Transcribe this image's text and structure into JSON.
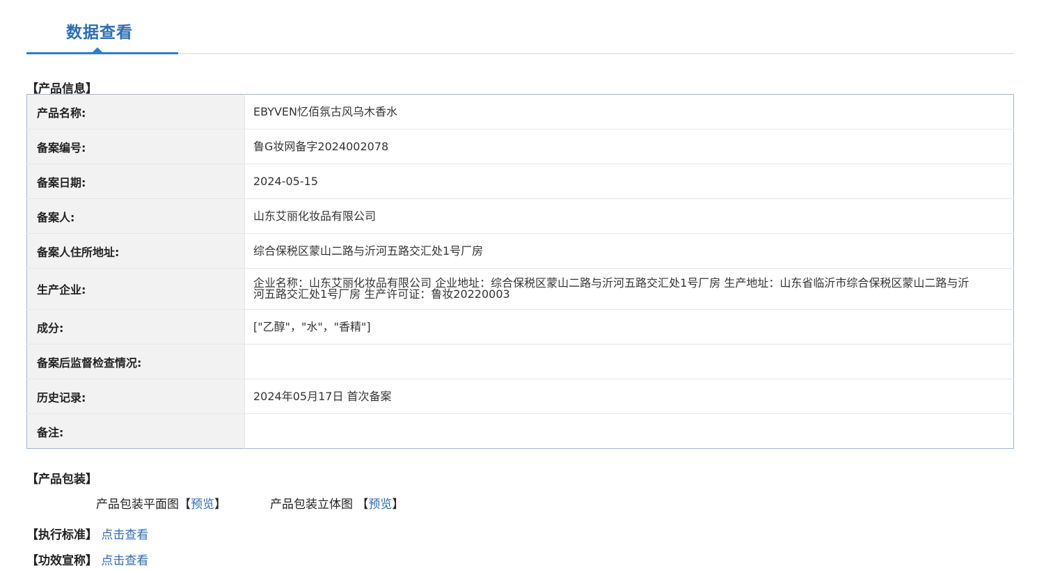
{
  "tab": {
    "title": "数据查看"
  },
  "product_info": {
    "heading": "【产品信息】",
    "rows": [
      {
        "label": "产品名称:",
        "value": "EBYVEN忆佰氛古风乌木香水"
      },
      {
        "label": "备案编号:",
        "value": "鲁G妆网备字2024002078"
      },
      {
        "label": "备案日期:",
        "value": "2024-05-15"
      },
      {
        "label": "备案人:",
        "value": "山东艾丽化妆品有限公司"
      },
      {
        "label": "备案人住所地址:",
        "value": "综合保税区蒙山二路与沂河五路交汇处1号厂房"
      },
      {
        "label": "生产企业:",
        "value": "企业名称：山东艾丽化妆品有限公司 企业地址：综合保税区蒙山二路与沂河五路交汇处1号厂房 生产地址：山东省临沂市综合保税区蒙山二路与沂河五路交汇处1号厂房 生产许可证：鲁妆20220003"
      },
      {
        "label": "成分:",
        "value": "[\"乙醇\"，\"水\"，\"香精\"]"
      },
      {
        "label": "备案后监督检查情况:",
        "value": ""
      },
      {
        "label": "历史记录:",
        "value": "2024年05月17日 首次备案"
      },
      {
        "label": "备注:",
        "value": ""
      }
    ]
  },
  "packaging": {
    "heading": "【产品包装】",
    "flat": {
      "label": "产品包装平面图",
      "open": "【",
      "link": "预览",
      "close": "】"
    },
    "stereo": {
      "label": "产品包装立体图 ",
      "open": "【",
      "link": "预览",
      "close": "】"
    }
  },
  "standard": {
    "label": "【执行标准】",
    "link": "点击查看"
  },
  "efficacy": {
    "label": "【功效宣称】",
    "link": "点击查看"
  }
}
